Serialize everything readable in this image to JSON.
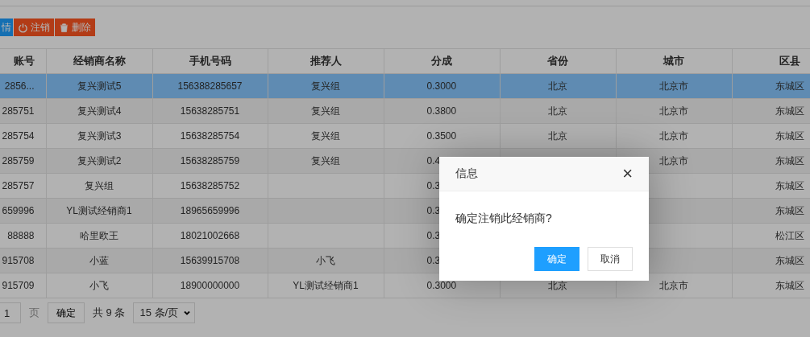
{
  "toolbar": [
    {
      "label": "情",
      "kind": "info"
    },
    {
      "label": "注销",
      "kind": "power"
    },
    {
      "label": "删除",
      "kind": "delete"
    }
  ],
  "table": {
    "columns": [
      "账号",
      "经销商名称",
      "手机号码",
      "推荐人",
      "分成",
      "省份",
      "城市",
      "区县"
    ],
    "rows": [
      {
        "selected": true,
        "cells": [
          "2856...",
          "复兴测试5",
          "156388285657",
          "复兴组",
          "0.3000",
          "北京",
          "北京市",
          "东城区"
        ]
      },
      {
        "selected": false,
        "cells": [
          "285751",
          "复兴测试4",
          "15638285751",
          "复兴组",
          "0.3800",
          "北京",
          "北京市",
          "东城区"
        ]
      },
      {
        "selected": false,
        "cells": [
          "285754",
          "复兴测试3",
          "15638285754",
          "复兴组",
          "0.3500",
          "北京",
          "北京市",
          "东城区"
        ]
      },
      {
        "selected": false,
        "cells": [
          "285759",
          "复兴测试2",
          "15638285759",
          "复兴组",
          "0.4",
          null,
          "北京市",
          "东城区"
        ]
      },
      {
        "selected": false,
        "cells": [
          "285757",
          "复兴组",
          "15638285752",
          null,
          "0.3",
          null,
          null,
          "东城区"
        ]
      },
      {
        "selected": false,
        "cells": [
          "659996",
          "YL测试经销商1",
          "18965659996",
          null,
          "0.3",
          null,
          null,
          "东城区"
        ]
      },
      {
        "selected": false,
        "cells": [
          "88888",
          "哈里欧王",
          "18021002668",
          null,
          "0.3",
          null,
          null,
          "松江区"
        ]
      },
      {
        "selected": false,
        "cells": [
          "915708",
          "小蓝",
          "15639915708",
          "小飞",
          "0.3",
          null,
          null,
          "东城区"
        ]
      },
      {
        "selected": false,
        "cells": [
          "915709",
          "小飞",
          "18900000000",
          "YL测试经销商1",
          "0.3000",
          "北京",
          "北京市",
          "东城区"
        ]
      }
    ]
  },
  "pagination": {
    "page": "1",
    "page_label": "页",
    "go_button": "确定",
    "total": "共 9 条",
    "page_size": "15 条/页"
  },
  "dialog": {
    "title": "信息",
    "close": "×",
    "message": "确定注销此经销商?",
    "buttons": [
      {
        "label": "确定",
        "kind": "primary"
      },
      {
        "label": "取消",
        "kind": "secondary"
      }
    ]
  }
}
